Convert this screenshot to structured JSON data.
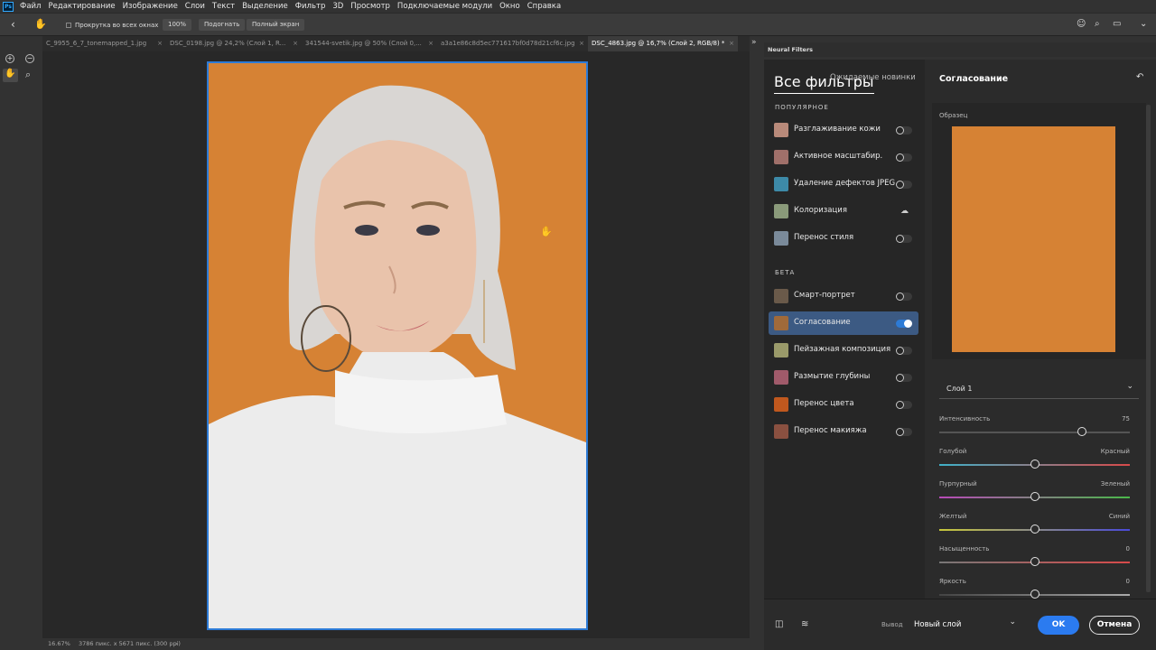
{
  "app": {
    "logo": "Ps"
  },
  "menu": [
    "Файл",
    "Редактирование",
    "Изображение",
    "Слои",
    "Текст",
    "Выделение",
    "Фильтр",
    "3D",
    "Просмотр",
    "Подключаемые модули",
    "Окно",
    "Справка"
  ],
  "options": {
    "scroll_all_label": "Прокрутка во всех окнах",
    "zoom_100": "100%",
    "fit": "Подогнать",
    "fullscreen": "Полный экран"
  },
  "tabs": [
    {
      "label": "C_9955_6_7_tonemapped_1.jpg",
      "active": false
    },
    {
      "label": "DSC_0198.jpg @ 24,2% (Слой 1, R...",
      "active": false
    },
    {
      "label": "341544-svetik.jpg @ 50% (Слой 0,...",
      "active": false
    },
    {
      "label": "a3a1e86c8d5ec771617bf0d78d21cf6c.jpg",
      "active": false
    },
    {
      "label": "DSC_4863.jpg @ 16,7% (Слой 2, RGB/8) *",
      "active": true
    }
  ],
  "status": {
    "zoom": "16.67%",
    "info": "3786 пикс. x 5671 пикс. (300 ppi)"
  },
  "colors": {
    "accent": "#2b7bf0",
    "sample": "#d68234",
    "selected": "#3c5a83"
  },
  "neural": {
    "panel_title": "Neural Filters",
    "tab_all": "Все фильтры",
    "tab_upcoming": "Ожидаемые новинки",
    "section_popular": "ПОПУЛЯРНОЕ",
    "section_beta": "БЕТА",
    "popular": [
      {
        "label": "Разглаживание кожи",
        "state": "off"
      },
      {
        "label": "Активное масштабир.",
        "state": "off"
      },
      {
        "label": "Удаление дефектов JPEG",
        "state": "off"
      },
      {
        "label": "Колоризация",
        "state": "cloud"
      },
      {
        "label": "Перенос стиля",
        "state": "off"
      }
    ],
    "beta": [
      {
        "label": "Смарт-портрет",
        "state": "off"
      },
      {
        "label": "Согласование",
        "state": "on"
      },
      {
        "label": "Пейзажная композиция",
        "state": "off"
      },
      {
        "label": "Размытие глубины",
        "state": "off"
      },
      {
        "label": "Перенос цвета",
        "state": "off"
      },
      {
        "label": "Перенос макияжа",
        "state": "off"
      }
    ],
    "detail": {
      "title": "Согласование",
      "sample_label": "Образец",
      "layer_select": "Слой 1",
      "sliders": [
        {
          "left": "Интенсивность",
          "right": "75",
          "value": 75,
          "min": 0,
          "max": 100
        },
        {
          "left": "Голубой",
          "right": "Красный",
          "value": 0,
          "min": -50,
          "max": 50
        },
        {
          "left": "Пурпурный",
          "right": "Зеленый",
          "value": 0,
          "min": -50,
          "max": 50
        },
        {
          "left": "Желтый",
          "right": "Синий",
          "value": 0,
          "min": -50,
          "max": 50
        },
        {
          "left": "Насыщенность",
          "right": "0",
          "value": 0,
          "min": -50,
          "max": 50
        },
        {
          "left": "Яркость",
          "right": "0",
          "value": 0,
          "min": -50,
          "max": 50
        }
      ]
    },
    "footer": {
      "output_label": "Вывод",
      "output_value": "Новый слой",
      "ok": "OK",
      "cancel": "Отмена"
    }
  }
}
